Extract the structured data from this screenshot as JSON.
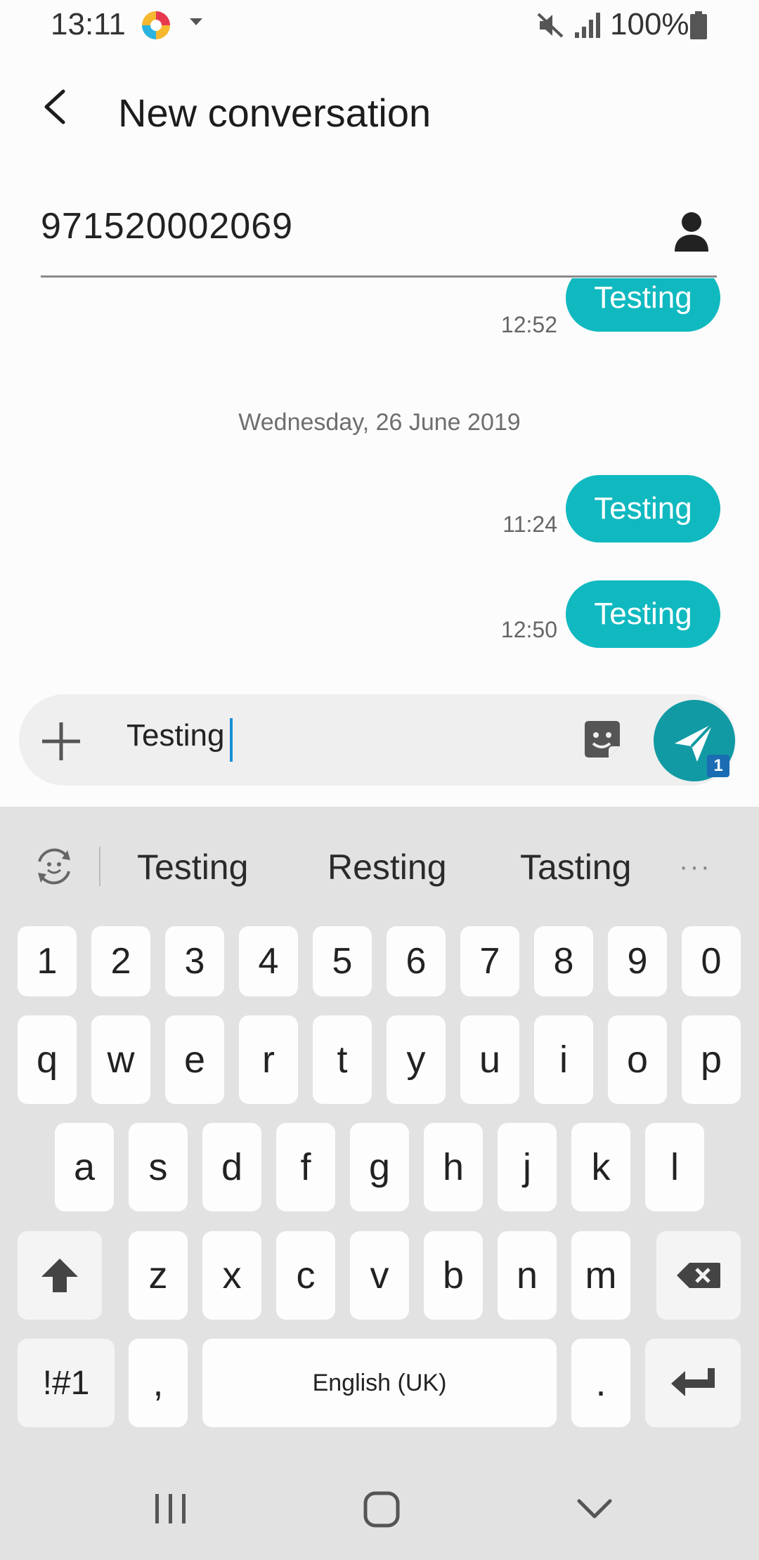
{
  "status_bar": {
    "time": "13:11",
    "battery": "100%"
  },
  "header": {
    "title": "New conversation"
  },
  "recipient": {
    "number": "971520002069"
  },
  "conversation": {
    "date_divider": "Wednesday, 26 June 2019",
    "messages": [
      {
        "text": "Testing",
        "time": "12:52"
      },
      {
        "text": "Testing",
        "time": "11:24"
      },
      {
        "text": "Testing",
        "time": "12:50"
      }
    ]
  },
  "composer": {
    "text": "Testing",
    "send_badge": "1"
  },
  "keyboard": {
    "suggestions": [
      "Testing",
      "Resting",
      "Tasting"
    ],
    "more": "···",
    "numbers": [
      "1",
      "2",
      "3",
      "4",
      "5",
      "6",
      "7",
      "8",
      "9",
      "0"
    ],
    "row1": [
      "q",
      "w",
      "e",
      "r",
      "t",
      "y",
      "u",
      "i",
      "o",
      "p"
    ],
    "row2": [
      "a",
      "s",
      "d",
      "f",
      "g",
      "h",
      "j",
      "k",
      "l"
    ],
    "row3": [
      "z",
      "x",
      "c",
      "v",
      "b",
      "n",
      "m"
    ],
    "symbols": "!#1",
    "comma": ",",
    "space": "English (UK)",
    "period": "."
  },
  "colors": {
    "bubble": "#10b9c0",
    "send": "#119aa3",
    "badge": "#1a6cb3",
    "cursor": "#1a8fd6"
  }
}
